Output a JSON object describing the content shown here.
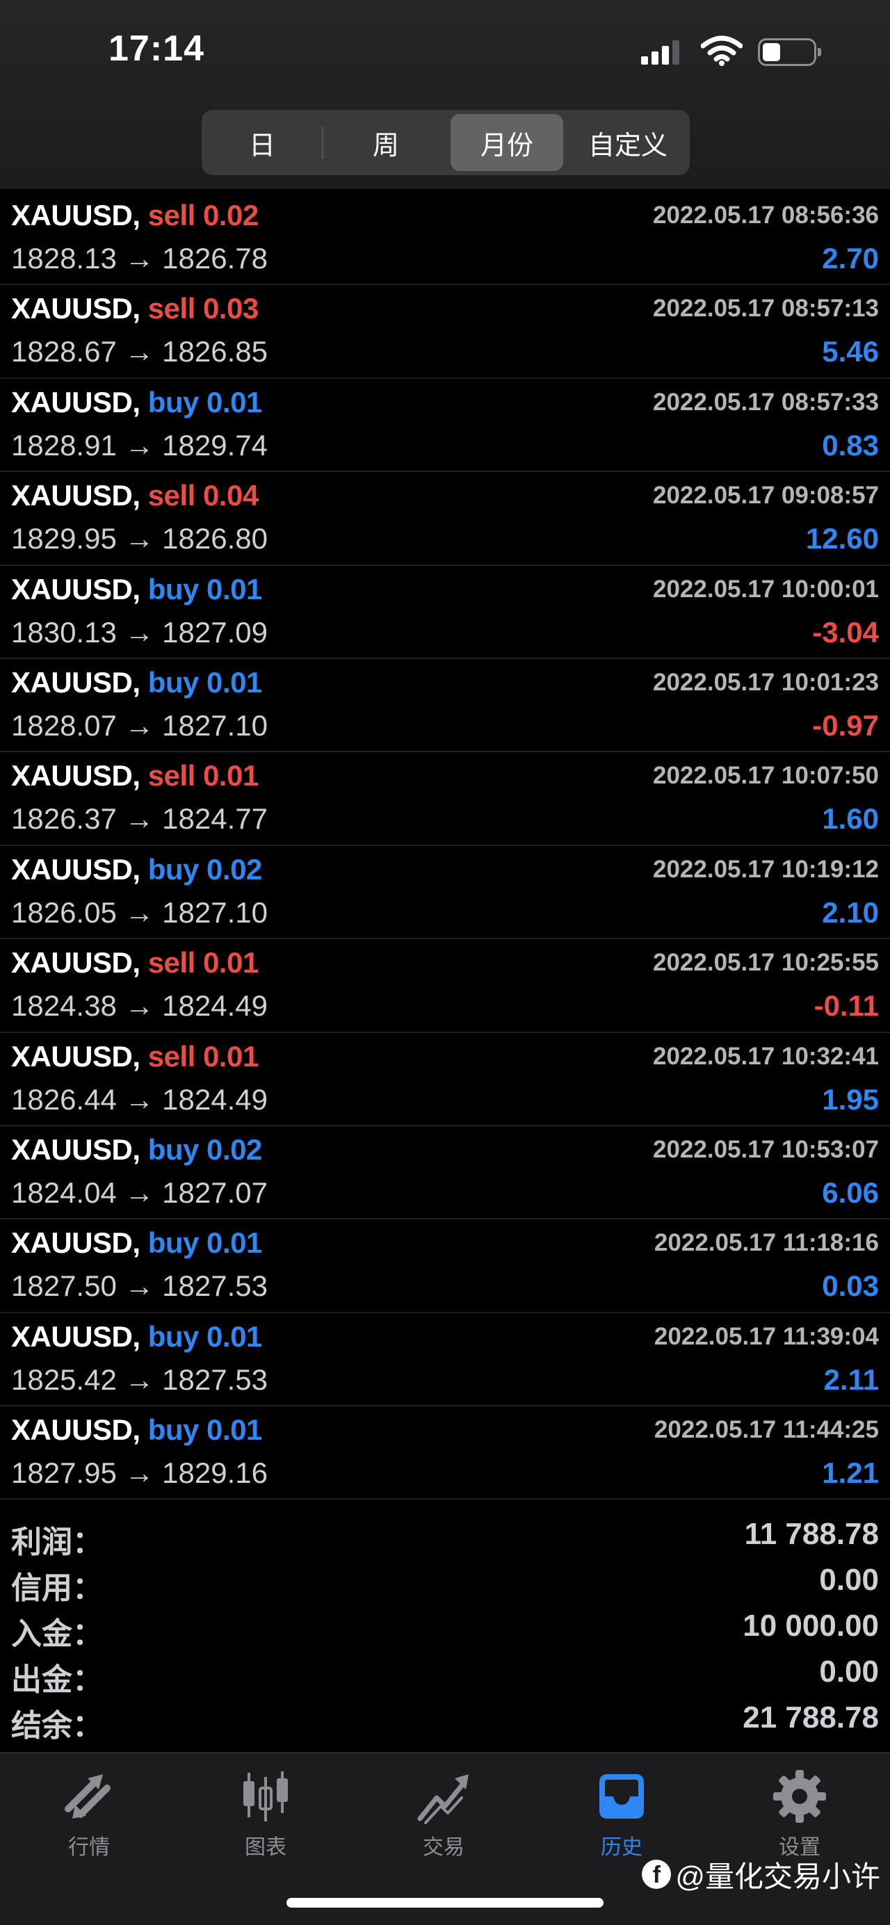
{
  "status_bar": {
    "time": "17:14",
    "battery_fraction": 0.35
  },
  "period_tabs": [
    {
      "label": "日",
      "active": false
    },
    {
      "label": "周",
      "active": false
    },
    {
      "label": "月份",
      "active": true
    },
    {
      "label": "自定义",
      "active": false
    }
  ],
  "trades": [
    {
      "symbol": "XAUUSD,",
      "side": "sell",
      "volume": "0.02",
      "time": "2022.05.17 08:56:36",
      "open": "1828.13",
      "close": "1826.78",
      "profit": "2.70"
    },
    {
      "symbol": "XAUUSD,",
      "side": "sell",
      "volume": "0.03",
      "time": "2022.05.17 08:57:13",
      "open": "1828.67",
      "close": "1826.85",
      "profit": "5.46"
    },
    {
      "symbol": "XAUUSD,",
      "side": "buy",
      "volume": "0.01",
      "time": "2022.05.17 08:57:33",
      "open": "1828.91",
      "close": "1829.74",
      "profit": "0.83"
    },
    {
      "symbol": "XAUUSD,",
      "side": "sell",
      "volume": "0.04",
      "time": "2022.05.17 09:08:57",
      "open": "1829.95",
      "close": "1826.80",
      "profit": "12.60"
    },
    {
      "symbol": "XAUUSD,",
      "side": "buy",
      "volume": "0.01",
      "time": "2022.05.17 10:00:01",
      "open": "1830.13",
      "close": "1827.09",
      "profit": "-3.04"
    },
    {
      "symbol": "XAUUSD,",
      "side": "buy",
      "volume": "0.01",
      "time": "2022.05.17 10:01:23",
      "open": "1828.07",
      "close": "1827.10",
      "profit": "-0.97"
    },
    {
      "symbol": "XAUUSD,",
      "side": "sell",
      "volume": "0.01",
      "time": "2022.05.17 10:07:50",
      "open": "1826.37",
      "close": "1824.77",
      "profit": "1.60"
    },
    {
      "symbol": "XAUUSD,",
      "side": "buy",
      "volume": "0.02",
      "time": "2022.05.17 10:19:12",
      "open": "1826.05",
      "close": "1827.10",
      "profit": "2.10"
    },
    {
      "symbol": "XAUUSD,",
      "side": "sell",
      "volume": "0.01",
      "time": "2022.05.17 10:25:55",
      "open": "1824.38",
      "close": "1824.49",
      "profit": "-0.11"
    },
    {
      "symbol": "XAUUSD,",
      "side": "sell",
      "volume": "0.01",
      "time": "2022.05.17 10:32:41",
      "open": "1826.44",
      "close": "1824.49",
      "profit": "1.95"
    },
    {
      "symbol": "XAUUSD,",
      "side": "buy",
      "volume": "0.02",
      "time": "2022.05.17 10:53:07",
      "open": "1824.04",
      "close": "1827.07",
      "profit": "6.06"
    },
    {
      "symbol": "XAUUSD,",
      "side": "buy",
      "volume": "0.01",
      "time": "2022.05.17 11:18:16",
      "open": "1827.50",
      "close": "1827.53",
      "profit": "0.03"
    },
    {
      "symbol": "XAUUSD,",
      "side": "buy",
      "volume": "0.01",
      "time": "2022.05.17 11:39:04",
      "open": "1825.42",
      "close": "1827.53",
      "profit": "2.11"
    },
    {
      "symbol": "XAUUSD,",
      "side": "buy",
      "volume": "0.01",
      "time": "2022.05.17 11:44:25",
      "open": "1827.95",
      "close": "1829.16",
      "profit": "1.21"
    }
  ],
  "arrow": "→",
  "summary": [
    {
      "label": "利润：",
      "value": "11 788.78"
    },
    {
      "label": "信用：",
      "value": "0.00"
    },
    {
      "label": "入金：",
      "value": "10 000.00"
    },
    {
      "label": "出金：",
      "value": "0.00"
    },
    {
      "label": "结余：",
      "value": "21 788.78"
    }
  ],
  "bottom_tabs": [
    {
      "label": "行情",
      "icon": "quotes-arrows-icon",
      "active": false
    },
    {
      "label": "图表",
      "icon": "candlestick-chart-icon",
      "active": false
    },
    {
      "label": "交易",
      "icon": "trade-chart-icon",
      "active": false
    },
    {
      "label": "历史",
      "icon": "history-tray-icon",
      "active": true
    },
    {
      "label": "设置",
      "icon": "gear-icon",
      "active": false
    }
  ],
  "watermark": {
    "text": "@量化交易小许",
    "logo": "f"
  },
  "colors": {
    "sell": "#ec4b46",
    "buy": "#2f87f3",
    "profit_positive": "#2f87f3",
    "profit_negative": "#ec4b46",
    "tab_active": "#2f87f3",
    "tab_inactive": "#8e8e93"
  }
}
